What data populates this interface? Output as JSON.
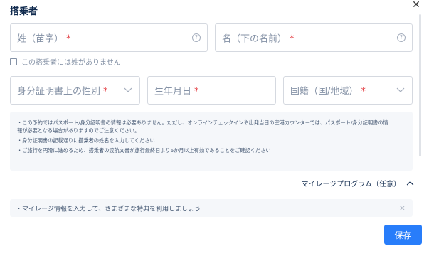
{
  "header": {
    "title": "搭乗者"
  },
  "fields": {
    "surname": {
      "label": "姓（苗字）",
      "required": "*"
    },
    "given_name": {
      "label": "名（下の名前）",
      "required": "*"
    },
    "gender": {
      "label": "身分証明書上の性別",
      "required": "*"
    },
    "birthdate": {
      "label": "生年月日",
      "required": "*"
    },
    "nationality": {
      "label": "国籍（国/地域）",
      "required": "*"
    }
  },
  "no_surname_checkbox": {
    "label": "この搭乗者には姓がありません",
    "checked": false
  },
  "notice": {
    "lines": [
      "・この予約ではパスポート/身分証明書の情報は必要ありません。ただし、オンラインチェックインや出発当日の空港カウンターでは、パスポート/身分証明書の情",
      "報が必要となる場合がありますのでご注意ください。",
      "・身分証明書の記載通りに搭乗者の姓名を入力してください",
      "・ご旅行を円滑に進めるため、搭乗者の渡航文書が旅行最終日より6か月以上有効であることをご確認ください"
    ]
  },
  "mileage": {
    "label": "マイレージプログラム（任意）"
  },
  "mileage_banner": {
    "text": "・マイレージ情報を入力して、さまざまな特典を利用しましょう"
  },
  "footer": {
    "save_label": "保存"
  },
  "colors": {
    "accent": "#287dfa",
    "required": "#e3383d",
    "text": "#0f294d",
    "muted": "#8592a6"
  },
  "icons": {
    "close": "close-icon",
    "help": "help-icon",
    "chevron_down": "chevron-down-icon",
    "chevron_up": "chevron-up-icon"
  }
}
